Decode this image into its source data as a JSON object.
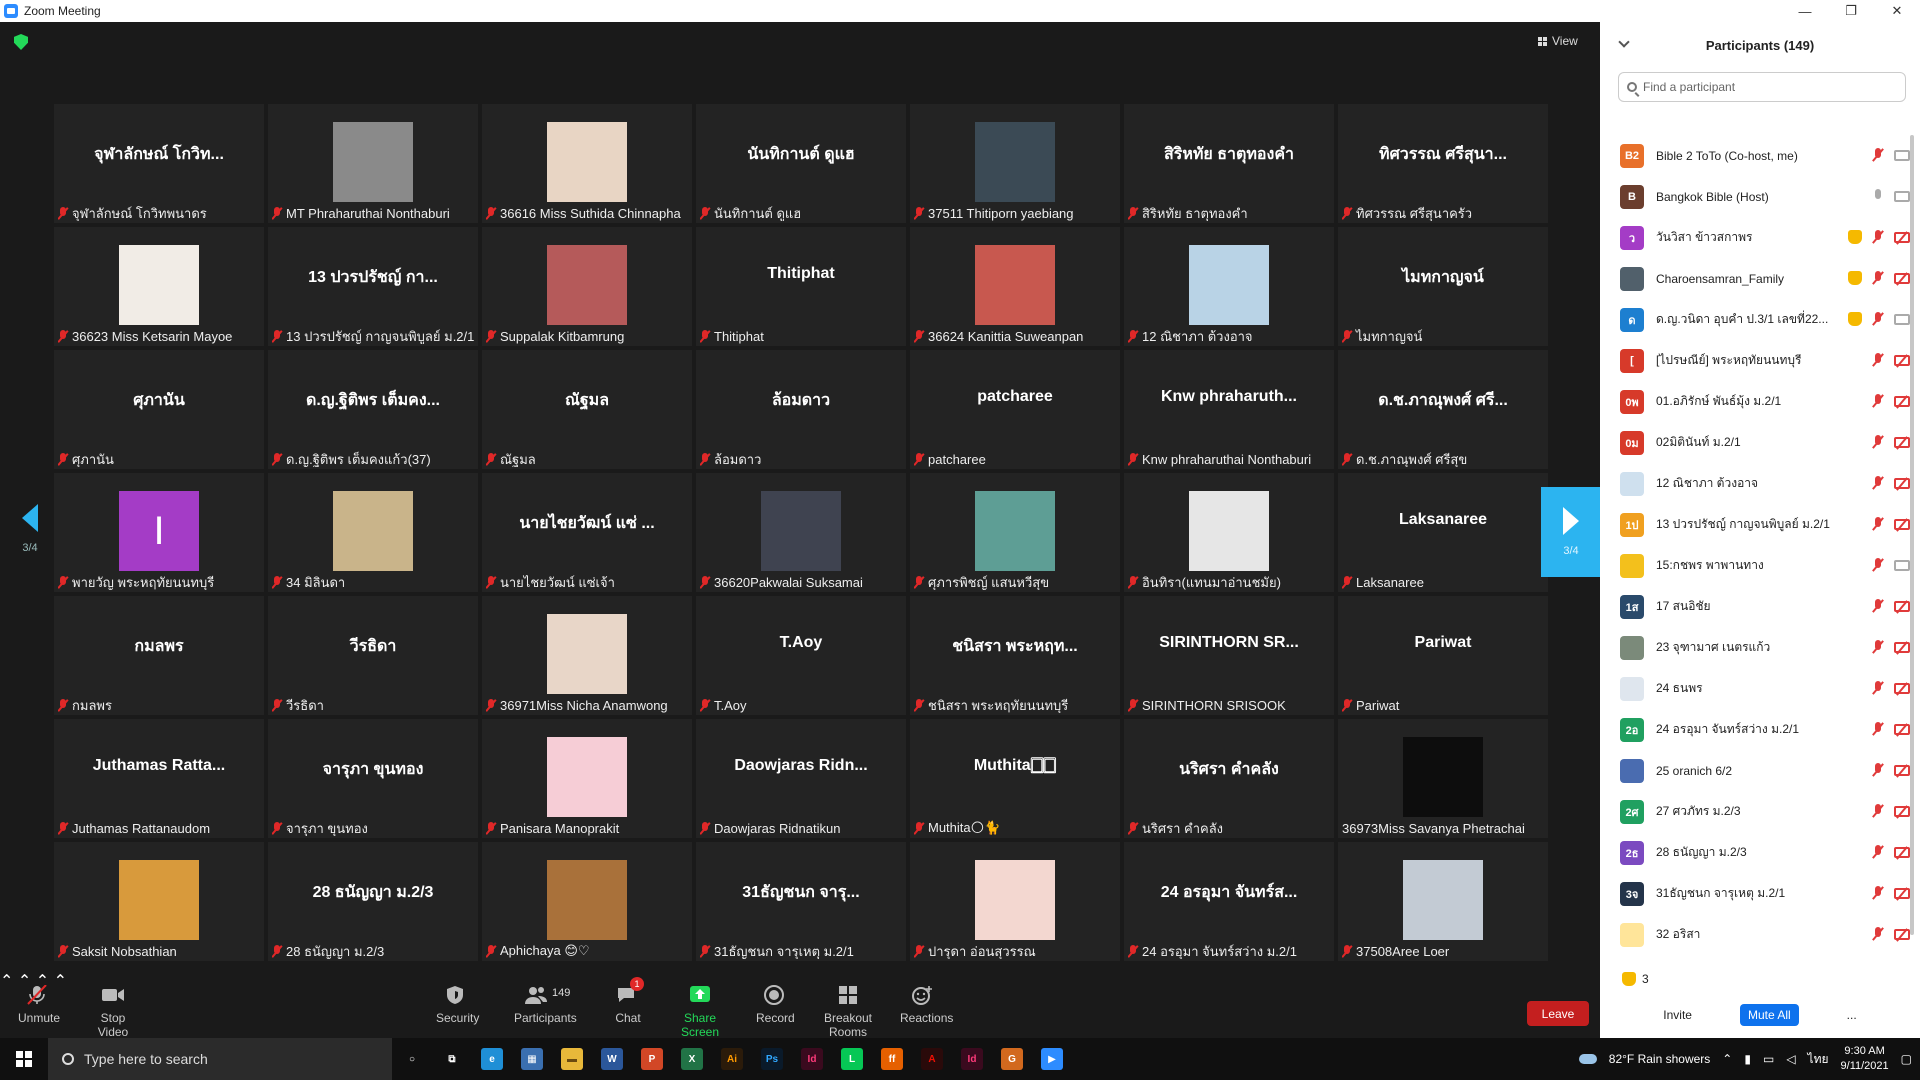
{
  "window": {
    "title": "Zoom Meeting",
    "controls": [
      "—",
      "❐",
      "✕"
    ]
  },
  "view_label": "View",
  "page_indicator": "3/4",
  "tiles": [
    {
      "big": "จุฬาลักษณ์ โกวิท...",
      "caption": "จุฬาลักษณ์ โกวิทพนาดร",
      "avatar": null
    },
    {
      "big": "",
      "caption": "MT Phraharuthai Nonthaburi",
      "avatar": "#8a8a8a"
    },
    {
      "big": "",
      "caption": "36616 Miss Suthida Chinnapha",
      "avatar": "#e8d5c4"
    },
    {
      "big": "นันทิกานต์ ดูแฮ",
      "caption": "นันทิกานต์ ดูแฮ",
      "avatar": null
    },
    {
      "big": "",
      "caption": "37511 Thitiporn yaebiang",
      "avatar": "#3b4a55"
    },
    {
      "big": "สิริหทัย ธาตุทองคำ",
      "caption": "สิริหทัย ธาตุทองคำ",
      "avatar": null
    },
    {
      "big": "ทิศวรรณ ศรีสุนา...",
      "caption": "ทิศวรรณ ศรีสุนาครัว",
      "avatar": null
    },
    {
      "big": "",
      "caption": "36623 Miss Ketsarin Mayoe",
      "avatar": "#f1ece6"
    },
    {
      "big": "13 ปวรปรัชญ์ กา...",
      "caption": "13 ปวรปรัชญ์ กาญจนพิบูลย์ ม.2/1",
      "avatar": null
    },
    {
      "big": "",
      "caption": "Suppalak Kitbamrung",
      "avatar": "#b55a5a"
    },
    {
      "big": "Thitiphat",
      "caption": "Thitiphat",
      "avatar": null
    },
    {
      "big": "",
      "caption": "36624 Kanittia Suweanpan",
      "avatar": "#c8584f"
    },
    {
      "big": "",
      "caption": "12 ณิชาภา ต้วงอาจ",
      "avatar": "#b9d3e6"
    },
    {
      "big": "ไมทกาญจน์",
      "caption": "ไมทกาญจน์",
      "avatar": null
    },
    {
      "big": "ศุภานัน",
      "caption": "ศุภานัน",
      "avatar": null
    },
    {
      "big": "ด.ญ.ฐิติพร เต็มคง...",
      "caption": "ด.ญ.ฐิติพร เต็มคงแก้ว(37)",
      "avatar": null
    },
    {
      "big": "ณัฐมล",
      "caption": "ณัฐมล",
      "avatar": null
    },
    {
      "big": "ล้อมดาว",
      "caption": "ล้อมดาว",
      "avatar": null
    },
    {
      "big": "patcharee",
      "caption": "patcharee",
      "avatar": null
    },
    {
      "big": "Knw phraharuth...",
      "caption": "Knw phraharuthai Nonthaburi",
      "avatar": null
    },
    {
      "big": "ด.ช.ภาณุพงศ์ ศรี...",
      "caption": "ด.ช.ภาณุพงศ์ ศรีสุข",
      "avatar": null
    },
    {
      "big": "",
      "caption": "พายวัญ พระหฤทัยนนทบุรี",
      "avatar": "#a43cc6",
      "letter": "I"
    },
    {
      "big": "",
      "caption": "34 มิลินดา",
      "avatar": "#c9b48a"
    },
    {
      "big": "นายไชยวัฒน์ แซ่ ...",
      "caption": "นายไชยวัฒน์ แซ่เจ้า",
      "avatar": null
    },
    {
      "big": "",
      "caption": "36620Pakwalai Suksamai",
      "avatar": "#3f4350"
    },
    {
      "big": "",
      "caption": "ศุภารพิชญ์ แสนหวีสุข",
      "avatar": "#5e9e95"
    },
    {
      "big": "",
      "caption": "อินทิรา(แทนมาอ่านชมัย)",
      "avatar": "#e6e6e6"
    },
    {
      "big": "Laksanaree",
      "caption": "Laksanaree",
      "avatar": null
    },
    {
      "big": "กมลพร",
      "caption": "กมลพร",
      "avatar": null
    },
    {
      "big": "วีรธิดา",
      "caption": "วีรธิดา",
      "avatar": null
    },
    {
      "big": "",
      "caption": "36971Miss Nicha Anamwong",
      "avatar": "#e8d6c8"
    },
    {
      "big": "T.Aoy",
      "caption": "T.Aoy",
      "avatar": null
    },
    {
      "big": "ชนิสรา พระหฤท...",
      "caption": "ชนิสรา พระหฤทัยนนทบุรี",
      "avatar": null
    },
    {
      "big": "SIRINTHORN SR...",
      "caption": "SIRINTHORN SRISOOK",
      "avatar": null
    },
    {
      "big": "Pariwat",
      "caption": "Pariwat",
      "avatar": null
    },
    {
      "big": "Juthamas Ratta...",
      "caption": "Juthamas Rattanaudom",
      "avatar": null
    },
    {
      "big": "จารุภา ขุนทอง",
      "caption": "จารุภา ขุนทอง",
      "avatar": null
    },
    {
      "big": "",
      "caption": "Panisara Manoprakit",
      "avatar": "#f6cdd6"
    },
    {
      "big": "Daowjaras Ridn...",
      "caption": "Daowjaras Ridnatikun",
      "avatar": null
    },
    {
      "big": "Muthita🀆🀆",
      "caption": "Muthita🌕🐈",
      "avatar": null
    },
    {
      "big": "นริศรา คำคลัง",
      "caption": "นริศรา คำคลัง",
      "avatar": null
    },
    {
      "big": "",
      "caption": "36973Miss Savanya Phetrachai",
      "avatar": "#0d0d0d",
      "nomic": true
    },
    {
      "big": "",
      "caption": "Saksit Nobsathian",
      "avatar": "#d89a3c"
    },
    {
      "big": "28 ธนัญญา ม.2/3",
      "caption": "28 ธนัญญา ม.2/3",
      "avatar": null
    },
    {
      "big": "",
      "caption": "Aphichaya 😊♡",
      "avatar": "#a9713a"
    },
    {
      "big": "31ธัญชนก    จารุ...",
      "caption": "31ธัญชนก    จารุเหตุ ม.2/1",
      "avatar": null
    },
    {
      "big": "",
      "caption": "ปารุดา อ่อนสุวรรณ",
      "avatar": "#f3d7d0"
    },
    {
      "big": "24 อรอุมา จันทร์ส...",
      "caption": "24 อรอุมา จันทร์สว่าง ม.2/1",
      "avatar": null
    },
    {
      "big": "",
      "caption": "37508Aree Loer",
      "avatar": "#c3cbd4"
    }
  ],
  "toolbar": {
    "unmute": "Unmute",
    "stop_video": "Stop Video",
    "security": "Security",
    "participants": "Participants",
    "participants_count": "149",
    "chat": "Chat",
    "chat_badge": "1",
    "share_screen": "Share Screen",
    "record": "Record",
    "breakout": "Breakout Rooms",
    "reactions": "Reactions",
    "leave": "Leave"
  },
  "panel": {
    "title": "Participants (149)",
    "search_placeholder": "Find a participant",
    "raised_count": "3",
    "invite": "Invite",
    "mute_all": "Mute All",
    "more": "...",
    "participants": [
      {
        "initial": "B2",
        "color": "#e8702a",
        "name": "Bible 2 ToTo (Co-host, me)",
        "hand": false,
        "mic": "off",
        "cam": "on"
      },
      {
        "initial": "B",
        "color": "#6b3e2e",
        "name": "Bangkok Bible (Host)",
        "hand": false,
        "mic": "on",
        "cam": "on"
      },
      {
        "initial": "ว",
        "color": "#a43cc6",
        "name": "วันวิสา ข้าวสกาพร",
        "hand": true,
        "mic": "off",
        "cam": "off"
      },
      {
        "initial": "",
        "color": "#51606b",
        "name": "Charoensamran_Family",
        "hand": true,
        "mic": "off",
        "cam": "off"
      },
      {
        "initial": "ด",
        "color": "#1d7fd0",
        "name": "ด.ญ.วนิดา อุบคำ ป.3/1 เลขที่22...",
        "hand": true,
        "mic": "off",
        "cam": "on"
      },
      {
        "initial": "[",
        "color": "#d73a2a",
        "name": "[ไปรษณีย์] พระหฤทัยนนทบุรี",
        "hand": false,
        "mic": "off",
        "cam": "off"
      },
      {
        "initial": "0พ",
        "color": "#d73a2a",
        "name": "01.อภิรักษ์ พันธ์มุ้ง ม.2/1",
        "hand": false,
        "mic": "off",
        "cam": "off"
      },
      {
        "initial": "0ม",
        "color": "#d73a2a",
        "name": "02มิตินันท์ ม.2/1",
        "hand": false,
        "mic": "off",
        "cam": "off"
      },
      {
        "initial": "",
        "color": "#cfe0ee",
        "name": "12 ณิชาภา ต้วงอาจ",
        "hand": false,
        "mic": "off",
        "cam": "off"
      },
      {
        "initial": "1ป",
        "color": "#f0a020",
        "name": "13 ปวรปรัชญ์ กาญจนพิบูลย์ ม.2/1",
        "hand": false,
        "mic": "off",
        "cam": "off"
      },
      {
        "initial": "",
        "color": "#f3c01c",
        "name": "15:กชพร พาพานทาง",
        "hand": false,
        "mic": "off",
        "cam": "on"
      },
      {
        "initial": "1ส",
        "color": "#2a4a6b",
        "name": "17 สนอิชัย",
        "hand": false,
        "mic": "off",
        "cam": "off"
      },
      {
        "initial": "",
        "color": "#7b8a7a",
        "name": "23 จุฑามาศ เนตรแก้ว",
        "hand": false,
        "mic": "off",
        "cam": "off"
      },
      {
        "initial": "",
        "color": "#dfe6ee",
        "name": "24 ธนพร",
        "hand": false,
        "mic": "off",
        "cam": "off"
      },
      {
        "initial": "2อ",
        "color": "#20a060",
        "name": "24 อรอุมา จันทร์สว่าง ม.2/1",
        "hand": false,
        "mic": "off",
        "cam": "off"
      },
      {
        "initial": "",
        "color": "#4a6cb0",
        "name": "25 oranich 6/2",
        "hand": false,
        "mic": "off",
        "cam": "off"
      },
      {
        "initial": "2ศ",
        "color": "#20a060",
        "name": "27 ศวภัทร  ม.2/3",
        "hand": false,
        "mic": "off",
        "cam": "off"
      },
      {
        "initial": "2ธ",
        "color": "#7b4ac0",
        "name": "28 ธนัญญา ม.2/3",
        "hand": false,
        "mic": "off",
        "cam": "off"
      },
      {
        "initial": "3จ",
        "color": "#24344a",
        "name": "31ธัญชนก    จารุเหตุ ม.2/1",
        "hand": false,
        "mic": "off",
        "cam": "off"
      },
      {
        "initial": "",
        "color": "#ffe59a",
        "name": "32 อริสา",
        "hand": false,
        "mic": "off",
        "cam": "off"
      }
    ]
  },
  "taskbar": {
    "search_placeholder": "Type here to search",
    "apps": [
      {
        "name": "cortana-icon",
        "label": "○",
        "bg": "transparent",
        "fg": "#fff"
      },
      {
        "name": "task-view-icon",
        "label": "⧉",
        "bg": "transparent",
        "fg": "#fff"
      },
      {
        "name": "edge-icon",
        "label": "e",
        "bg": "#1f8fd6",
        "fg": "#fff"
      },
      {
        "name": "calculator-icon",
        "label": "▦",
        "bg": "#3a6fb0",
        "fg": "#fff"
      },
      {
        "name": "file-explorer-icon",
        "label": "▬",
        "bg": "#e8b83a",
        "fg": "#6a4a10"
      },
      {
        "name": "word-icon",
        "label": "W",
        "bg": "#2b579a",
        "fg": "#fff"
      },
      {
        "name": "powerpoint-icon",
        "label": "P",
        "bg": "#d24726",
        "fg": "#fff"
      },
      {
        "name": "excel-icon",
        "label": "X",
        "bg": "#217346",
        "fg": "#fff"
      },
      {
        "name": "illustrator-icon",
        "label": "Ai",
        "bg": "#2b1b0a",
        "fg": "#ff9a00"
      },
      {
        "name": "photoshop-icon",
        "label": "Ps",
        "bg": "#0a1a2a",
        "fg": "#31a8ff"
      },
      {
        "name": "indesign-icon",
        "label": "Id",
        "bg": "#3a0a1e",
        "fg": "#ff3a7a"
      },
      {
        "name": "line-icon",
        "label": "L",
        "bg": "#06c755",
        "fg": "#fff"
      },
      {
        "name": "firefox-icon",
        "label": "ff",
        "bg": "#e66000",
        "fg": "#fff"
      },
      {
        "name": "acrobat-icon",
        "label": "A",
        "bg": "#2a0a0a",
        "fg": "#f40f02"
      },
      {
        "name": "indesign2-icon",
        "label": "Id",
        "bg": "#3a0a1e",
        "fg": "#ff3a7a"
      },
      {
        "name": "grammarly-icon",
        "label": "G",
        "bg": "#d2691e",
        "fg": "#fff"
      },
      {
        "name": "zoom-icon",
        "label": "▶",
        "bg": "#2d8cff",
        "fg": "#fff"
      }
    ],
    "weather": "82°F  Rain showers",
    "lang": "ไทย",
    "time": "9:30 AM",
    "date": "9/11/2021"
  }
}
